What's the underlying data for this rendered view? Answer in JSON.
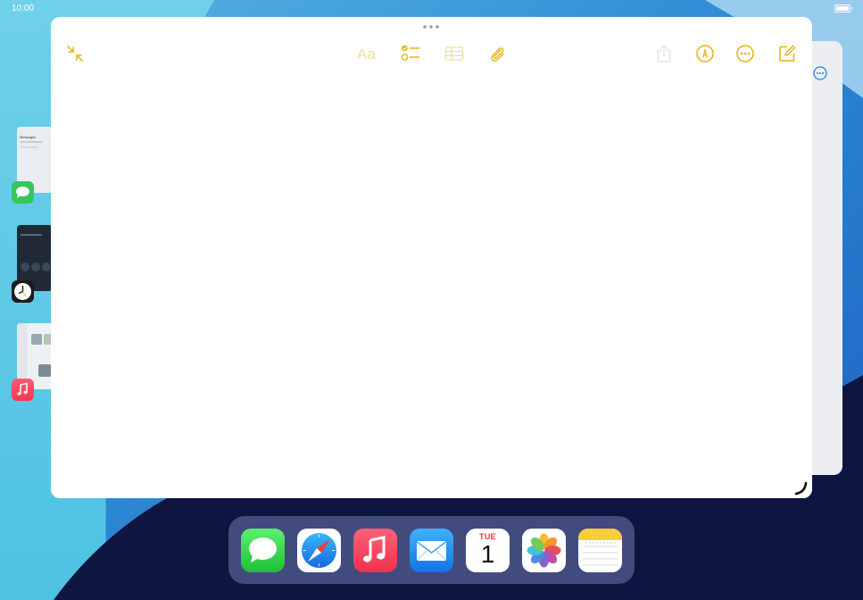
{
  "status_bar": {
    "time": "10:00",
    "battery": "battery-icon"
  },
  "colors": {
    "accent": "#E8B10E",
    "accent_disabled": "#EEDFA6",
    "system_blue": "#2F7FE0",
    "wallpaper_light": "#5BC7E6",
    "wallpaper_dark": "#0E1541"
  },
  "stage_manager": {
    "items": [
      {
        "app": "Messages",
        "icon": "messages-icon",
        "preview_title": "Messages"
      },
      {
        "app": "Clock",
        "icon": "clock-icon"
      },
      {
        "app": "Music",
        "icon": "music-icon"
      }
    ]
  },
  "notes_window": {
    "toolbar": {
      "exit_full_screen": "collapse-arrows-icon",
      "format": "Aa",
      "checklist": "checklist-icon",
      "table": "table-icon",
      "attachment": "paperclip-icon",
      "share": "share-icon",
      "markup": "markup-pen-icon",
      "more": "ellipsis-circle-icon",
      "compose": "compose-icon"
    }
  },
  "dock": {
    "apps": [
      {
        "name": "Messages",
        "icon": "messages-icon"
      },
      {
        "name": "Safari",
        "icon": "safari-compass-icon"
      },
      {
        "name": "Music",
        "icon": "music-note-icon"
      },
      {
        "name": "Mail",
        "icon": "envelope-icon"
      },
      {
        "name": "Calendar",
        "icon": "calendar-icon",
        "day": "TUE",
        "date": "1"
      },
      {
        "name": "Photos",
        "icon": "photos-flower-icon"
      },
      {
        "name": "Notes",
        "icon": "notes-icon"
      }
    ]
  }
}
